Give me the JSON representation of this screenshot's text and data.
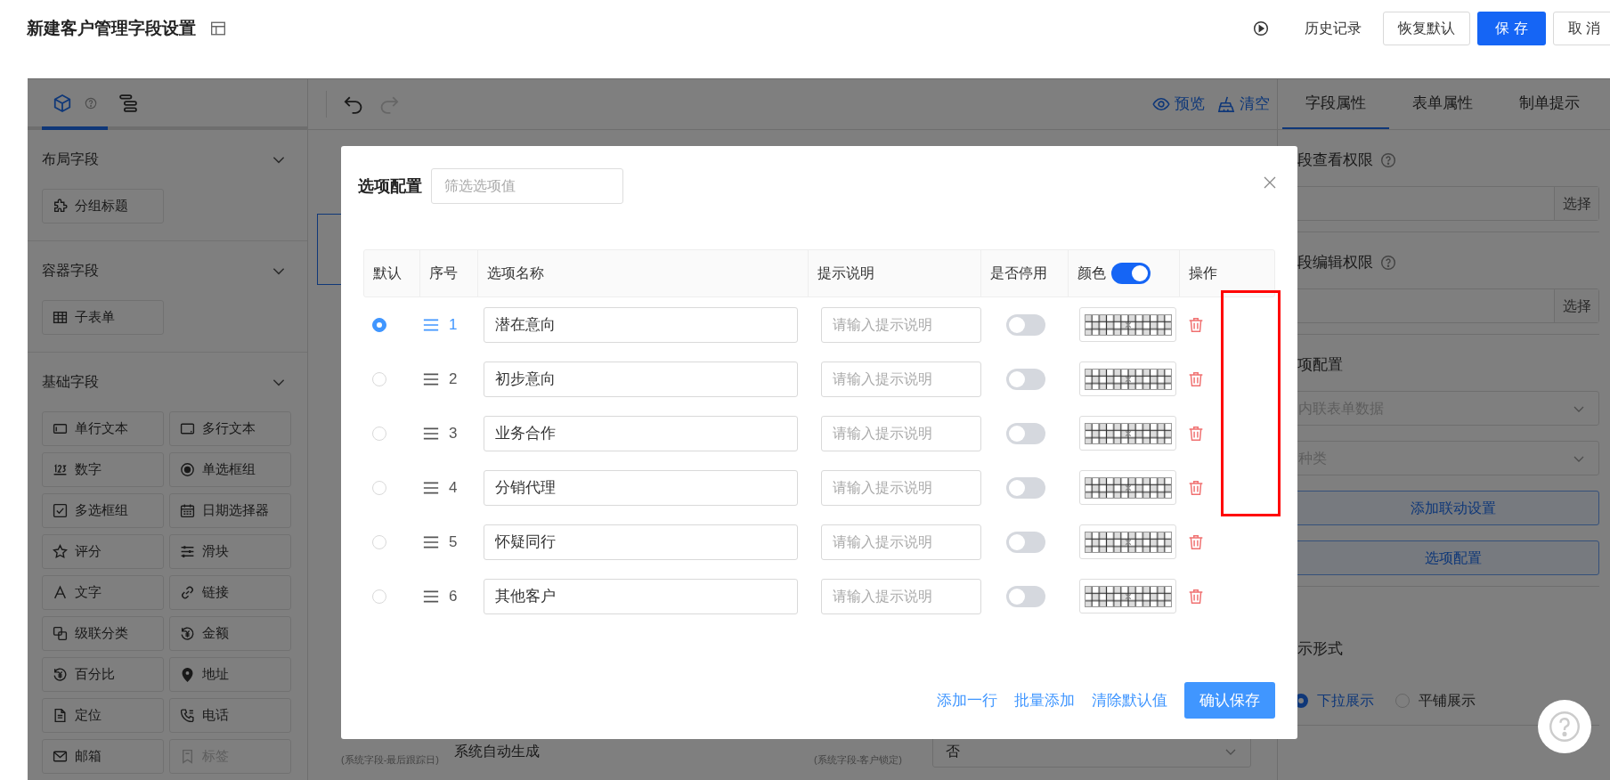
{
  "header": {
    "title": "新建客户管理字段设置",
    "actions": [
      {
        "label": "历史记录",
        "kind": "text"
      },
      {
        "label": "恢复默认",
        "kind": "default"
      },
      {
        "label": "保 存",
        "kind": "primary"
      },
      {
        "label": "取 消",
        "kind": "default"
      }
    ]
  },
  "left_panel": {
    "tabs": [
      {
        "kind": "components",
        "selected": true
      },
      {
        "kind": "outline",
        "selected": false
      }
    ],
    "sections": [
      {
        "title": "布局字段",
        "expanded": true,
        "items": [
          {
            "label": "分组标题",
            "disabled": false
          }
        ]
      },
      {
        "title": "容器字段",
        "expanded": true,
        "items": [
          {
            "label": "子表单",
            "disabled": false
          }
        ]
      },
      {
        "title": "基础字段",
        "expanded": true,
        "items": [
          {
            "label": "单行文本",
            "disabled": false
          },
          {
            "label": "多行文本",
            "disabled": false
          },
          {
            "label": "数字",
            "disabled": false
          },
          {
            "label": "单选框组",
            "disabled": false
          },
          {
            "label": "多选框组",
            "disabled": false
          },
          {
            "label": "日期选择器",
            "disabled": false
          },
          {
            "label": "评分",
            "disabled": false
          },
          {
            "label": "滑块",
            "disabled": false
          },
          {
            "label": "文字",
            "disabled": false
          },
          {
            "label": "链接",
            "disabled": false
          },
          {
            "label": "级联分类",
            "disabled": false
          },
          {
            "label": "金额",
            "disabled": false
          },
          {
            "label": "百分比",
            "disabled": false
          },
          {
            "label": "地址",
            "disabled": false
          },
          {
            "label": "定位",
            "disabled": false
          },
          {
            "label": "电话",
            "disabled": false
          },
          {
            "label": "邮箱",
            "disabled": false
          },
          {
            "label": "标签",
            "disabled": true
          }
        ]
      }
    ]
  },
  "canvas": {
    "history": [
      {
        "kind": "undo",
        "disabled": false
      },
      {
        "kind": "redo",
        "disabled": true
      }
    ],
    "tools": [
      {
        "kind": "preview",
        "label": "预览"
      },
      {
        "kind": "clear",
        "label": "清空"
      }
    ],
    "bottom_fields": [
      {
        "kind": "text",
        "hint": "(系统字段-最后跟踪日)",
        "value": "系统自动生成"
      },
      {
        "kind": "select",
        "hint": "(系统字段-客户锁定)",
        "value": "否"
      }
    ]
  },
  "right_panel": {
    "tabs": [
      {
        "label": "字段属性",
        "selected": true
      },
      {
        "label": "表单属性",
        "selected": false
      },
      {
        "label": "制单提示",
        "selected": false
      }
    ],
    "groups": [
      [
        {
          "kind": "label",
          "text": "段查看权限",
          "help": true
        },
        {
          "kind": "picker",
          "button": "选择"
        }
      ],
      [
        {
          "kind": "label",
          "text": "段编辑权限",
          "help": true
        },
        {
          "kind": "picker",
          "button": "选择"
        }
      ],
      [
        {
          "kind": "label",
          "text": "项配置",
          "help": false
        },
        {
          "kind": "select",
          "placeholder": "内联表单数据"
        },
        {
          "kind": "select",
          "placeholder": "种类"
        },
        {
          "kind": "button",
          "text": "添加联动设置"
        },
        {
          "kind": "button",
          "text": "选项配置"
        }
      ],
      [
        {
          "kind": "label",
          "text": "示形式",
          "help": false
        },
        {
          "kind": "radios",
          "options": [
            {
              "label": "下拉展示",
              "selected": true
            },
            {
              "label": "平铺展示",
              "selected": false
            }
          ]
        }
      ]
    ]
  },
  "modal": {
    "title": "选项配置",
    "filter": {
      "placeholder": "筛选选项值"
    },
    "columns": [
      {
        "label": "默认",
        "kind": "text"
      },
      {
        "label": "序号",
        "kind": "text"
      },
      {
        "label": "选项名称",
        "kind": "text"
      },
      {
        "label": "提示说明",
        "kind": "text"
      },
      {
        "label": "是否停用",
        "kind": "text"
      },
      {
        "label": "颜色",
        "kind": "toggle",
        "on": true
      },
      {
        "label": "操作",
        "kind": "text"
      }
    ],
    "rows": [
      {
        "selected": true,
        "highlighted": true,
        "index": "1",
        "name": "潜在意向",
        "hint_placeholder": "请输入提示说明",
        "disabled": false
      },
      {
        "selected": false,
        "highlighted": false,
        "index": "2",
        "name": "初步意向",
        "hint_placeholder": "请输入提示说明",
        "disabled": false
      },
      {
        "selected": false,
        "highlighted": false,
        "index": "3",
        "name": "业务合作",
        "hint_placeholder": "请输入提示说明",
        "disabled": false
      },
      {
        "selected": false,
        "highlighted": false,
        "index": "4",
        "name": "分销代理",
        "hint_placeholder": "请输入提示说明",
        "disabled": false
      },
      {
        "selected": false,
        "highlighted": false,
        "index": "5",
        "name": "怀疑同行",
        "hint_placeholder": "请输入提示说明",
        "disabled": false
      },
      {
        "selected": false,
        "highlighted": false,
        "index": "6",
        "name": "其他客户",
        "hint_placeholder": "请输入提示说明",
        "disabled": false
      }
    ],
    "footer": {
      "links": [
        "添加一行",
        "批量添加",
        "清除默认值"
      ],
      "confirm": "确认保存"
    }
  },
  "annotation": {
    "kind": "frame"
  }
}
